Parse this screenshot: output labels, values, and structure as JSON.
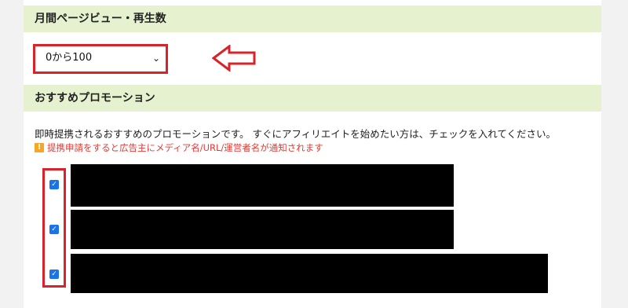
{
  "monthly_views": {
    "header": "月間ページビュー・再生数",
    "select_value": "0から100"
  },
  "promotions": {
    "header": "おすすめプロモーション",
    "description": "即時提携されるおすすめのプロモーションです。 すぐにアフィリエイトを始めたい方は、チェックを入れてください。",
    "warning": "提携申請をすると広告主にメディア名/URL/運営者名が通知されます",
    "items": [
      {
        "checked": true
      },
      {
        "checked": true
      },
      {
        "checked": true
      }
    ]
  },
  "colors": {
    "highlight": "#d8232a",
    "header_bg": "#e6f2cf",
    "warning_text": "#e53935",
    "checkbox": "#1a73e8"
  },
  "icons": {
    "arrow": "left-arrow-outline-icon",
    "warning": "warning-icon",
    "chevron": "chevron-down-icon"
  }
}
